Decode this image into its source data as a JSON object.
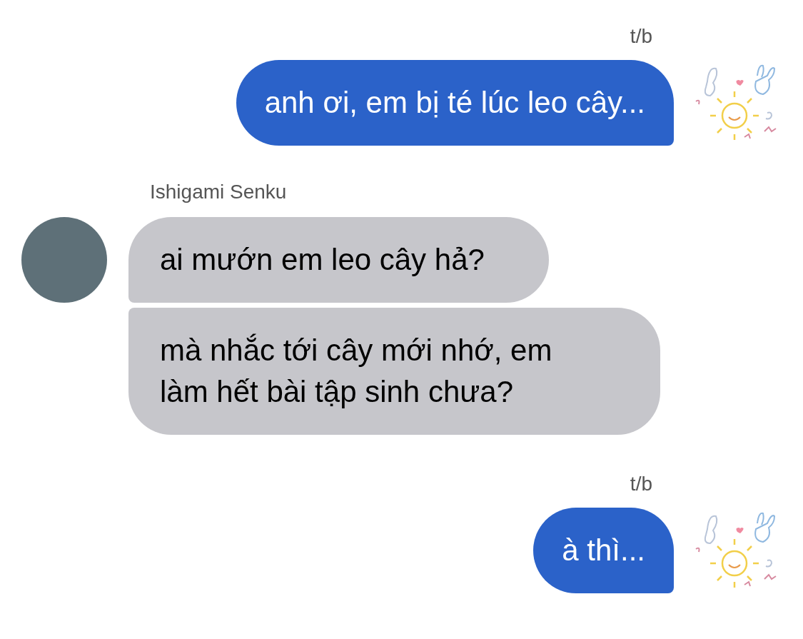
{
  "messages": [
    {
      "kind": "outgoing",
      "sender": "t/b",
      "texts": [
        "anh ơi, em bị té lúc leo cây..."
      ]
    },
    {
      "kind": "incoming",
      "sender": "Ishigami Senku",
      "texts": [
        "ai mướn em leo cây hả?",
        "mà nhắc tới cây mới nhớ, em làm hết bài tập sinh chưa?"
      ]
    },
    {
      "kind": "outgoing",
      "sender": "t/b",
      "texts": [
        "à thì..."
      ]
    }
  ]
}
